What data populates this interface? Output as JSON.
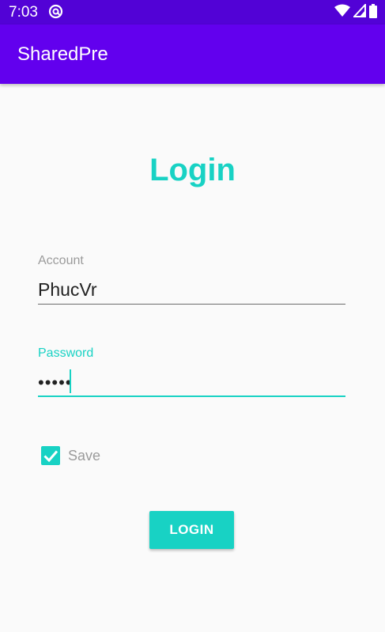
{
  "status_bar": {
    "time": "7:03",
    "app_icon": "at-sync-icon",
    "icons": [
      "wifi-icon",
      "cellular-signal-icon",
      "battery-icon"
    ]
  },
  "app_bar": {
    "title": "SharedPre"
  },
  "form": {
    "title": "Login",
    "account": {
      "label": "Account",
      "value": "PhucVr"
    },
    "password": {
      "label": "Password",
      "value": "•••••"
    },
    "save": {
      "label": "Save",
      "checked": true
    },
    "login_button_label": "LOGIN"
  },
  "colors": {
    "accent": "#18d2c4",
    "app_bar": "#6200ee",
    "status_bar": "#5202d6"
  }
}
